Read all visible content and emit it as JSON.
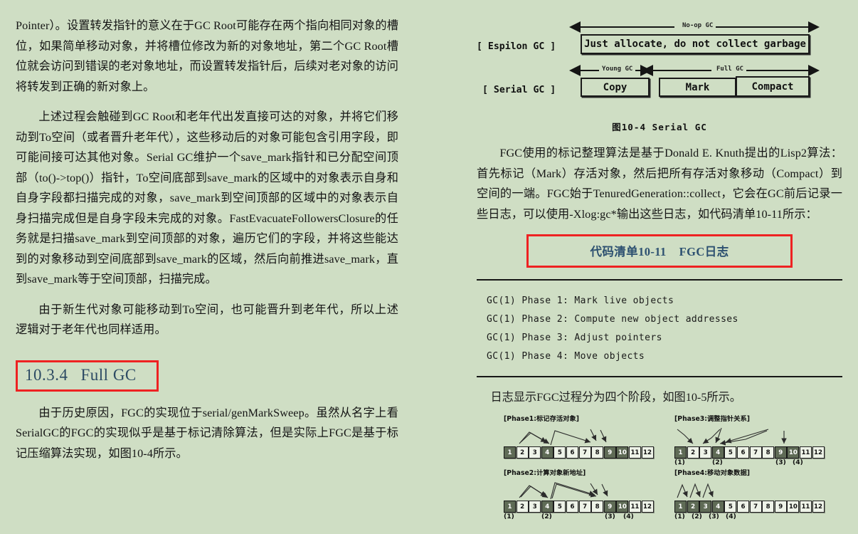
{
  "page": {
    "background_color": "#cfdec4",
    "heading_accent_color": "#2c4a63",
    "highlight_border_color": "#ee2222"
  },
  "left_column": {
    "paragraphs": [
      "Pointer）。设置转发指针的意义在于GC Root可能存在两个指向相同对象的槽位，如果简单移动对象，并将槽位修改为新的对象地址，第二个GC Root槽位就会访问到错误的老对象地址，而设置转发指针后，后续对老对象的访问将转发到正确的新对象上。",
      "上述过程会触碰到GC Root和老年代出发直接可达的对象，并将它们移动到To空间（或者晋升老年代），这些移动后的对象可能包含引用字段，即可能间接可达其他对象。Serial GC维护一个save_mark指针和已分配空间顶部（to()->top()）指针，To空间底部到save_mark的区域中的对象表示自身和自身字段都扫描完成的对象，save_mark到空间顶部的区域中的对象表示自身扫描完成但是自身字段未完成的对象。FastEvacuateFollowersClosure的任务就是扫描save_mark到空间顶部的对象，遍历它们的字段，并将这些能达到的对象移动到空间底部到save_mark的区域，然后向前推进save_mark，直到save_mark等于空间顶部，扫描完成。",
      "由于新生代对象可能移动到To空间，也可能晋升到老年代，所以上述逻辑对于老年代也同样适用。"
    ],
    "section_heading": {
      "number": "10.3.4",
      "title": "Full GC"
    },
    "paragraph_after_heading": "由于历史原因，FGC的实现位于serial/genMarkSweep。虽然从名字上看SerialGC的FGC的实现似乎是基于标记清除算法，但是实际上FGC是基于标记压缩算法实现，如图10-4所示。"
  },
  "right_column": {
    "figure_10_4": {
      "caption": "图10-4  Serial GC",
      "rows": [
        {
          "label": "[ Espilon GC ]",
          "arrow_label": "No-op GC",
          "boxes": [
            {
              "text": "Just allocate, do not collect garbage"
            }
          ]
        },
        {
          "label": "[ Serial GC ]",
          "arrow_labels": [
            "Young GC",
            "Full GC"
          ],
          "boxes": [
            {
              "text": "Copy"
            },
            {
              "text": "Mark"
            },
            {
              "text": "Compact"
            }
          ]
        }
      ]
    },
    "paragraph": "FGC使用的标记整理算法是基于Donald E. Knuth提出的Lisp2算法：首先标记（Mark）存活对象，然后把所有存活对象移动（Compact）到空间的一端。FGC始于TenuredGeneration::collect，它会在GC前后记录一些日志，可以使用-Xlog:gc*输出这些日志，如代码清单10-11所示：",
    "listing_caption": {
      "number": "代码清单10-11",
      "title": "FGC日志"
    },
    "code_lines": [
      "GC(1) Phase 1: Mark live objects",
      "GC(1) Phase 2: Compute new object addresses",
      "GC(1) Phase 3: Adjust pointers",
      "GC(1) Phase 4: Move objects"
    ],
    "figure_10_5": {
      "intro": "日志显示FGC过程分为四个阶段，如图10-5所示。",
      "cell_labels": [
        "1",
        "2",
        "3",
        "4",
        "5",
        "6",
        "7",
        "8",
        "9",
        "10",
        "11",
        "12"
      ],
      "phases": [
        {
          "title": "[Phase1:标记存活对象]",
          "highlighted": [
            1,
            4,
            9,
            10
          ],
          "markers": []
        },
        {
          "title": "[Phase2:计算对象新地址]",
          "highlighted": [
            1,
            4,
            9,
            10
          ],
          "markers": [
            {
              "text": "(1)",
              "cell": 1
            },
            {
              "text": "(2)",
              "cell": 4
            },
            {
              "text": "(3)",
              "cell": 9
            },
            {
              "text": "(4)",
              "cell": 10
            }
          ]
        },
        {
          "title": "[Phase3:调整指针关系]",
          "highlighted": [
            1,
            4,
            9,
            10
          ],
          "markers": [
            {
              "text": "(1)",
              "cell": 1
            },
            {
              "text": "(2)",
              "cell": 4
            },
            {
              "text": "(3)",
              "cell": 9
            },
            {
              "text": "(4)",
              "cell": 10
            }
          ]
        },
        {
          "title": "[Phase4:移动对象数据]",
          "highlighted": [
            1,
            2,
            3,
            4
          ],
          "markers": [
            {
              "text": "(1)",
              "cell": 1
            },
            {
              "text": "(2)",
              "cell": 2
            },
            {
              "text": "(3)",
              "cell": 3
            },
            {
              "text": "(4)",
              "cell": 4
            }
          ]
        }
      ]
    }
  }
}
